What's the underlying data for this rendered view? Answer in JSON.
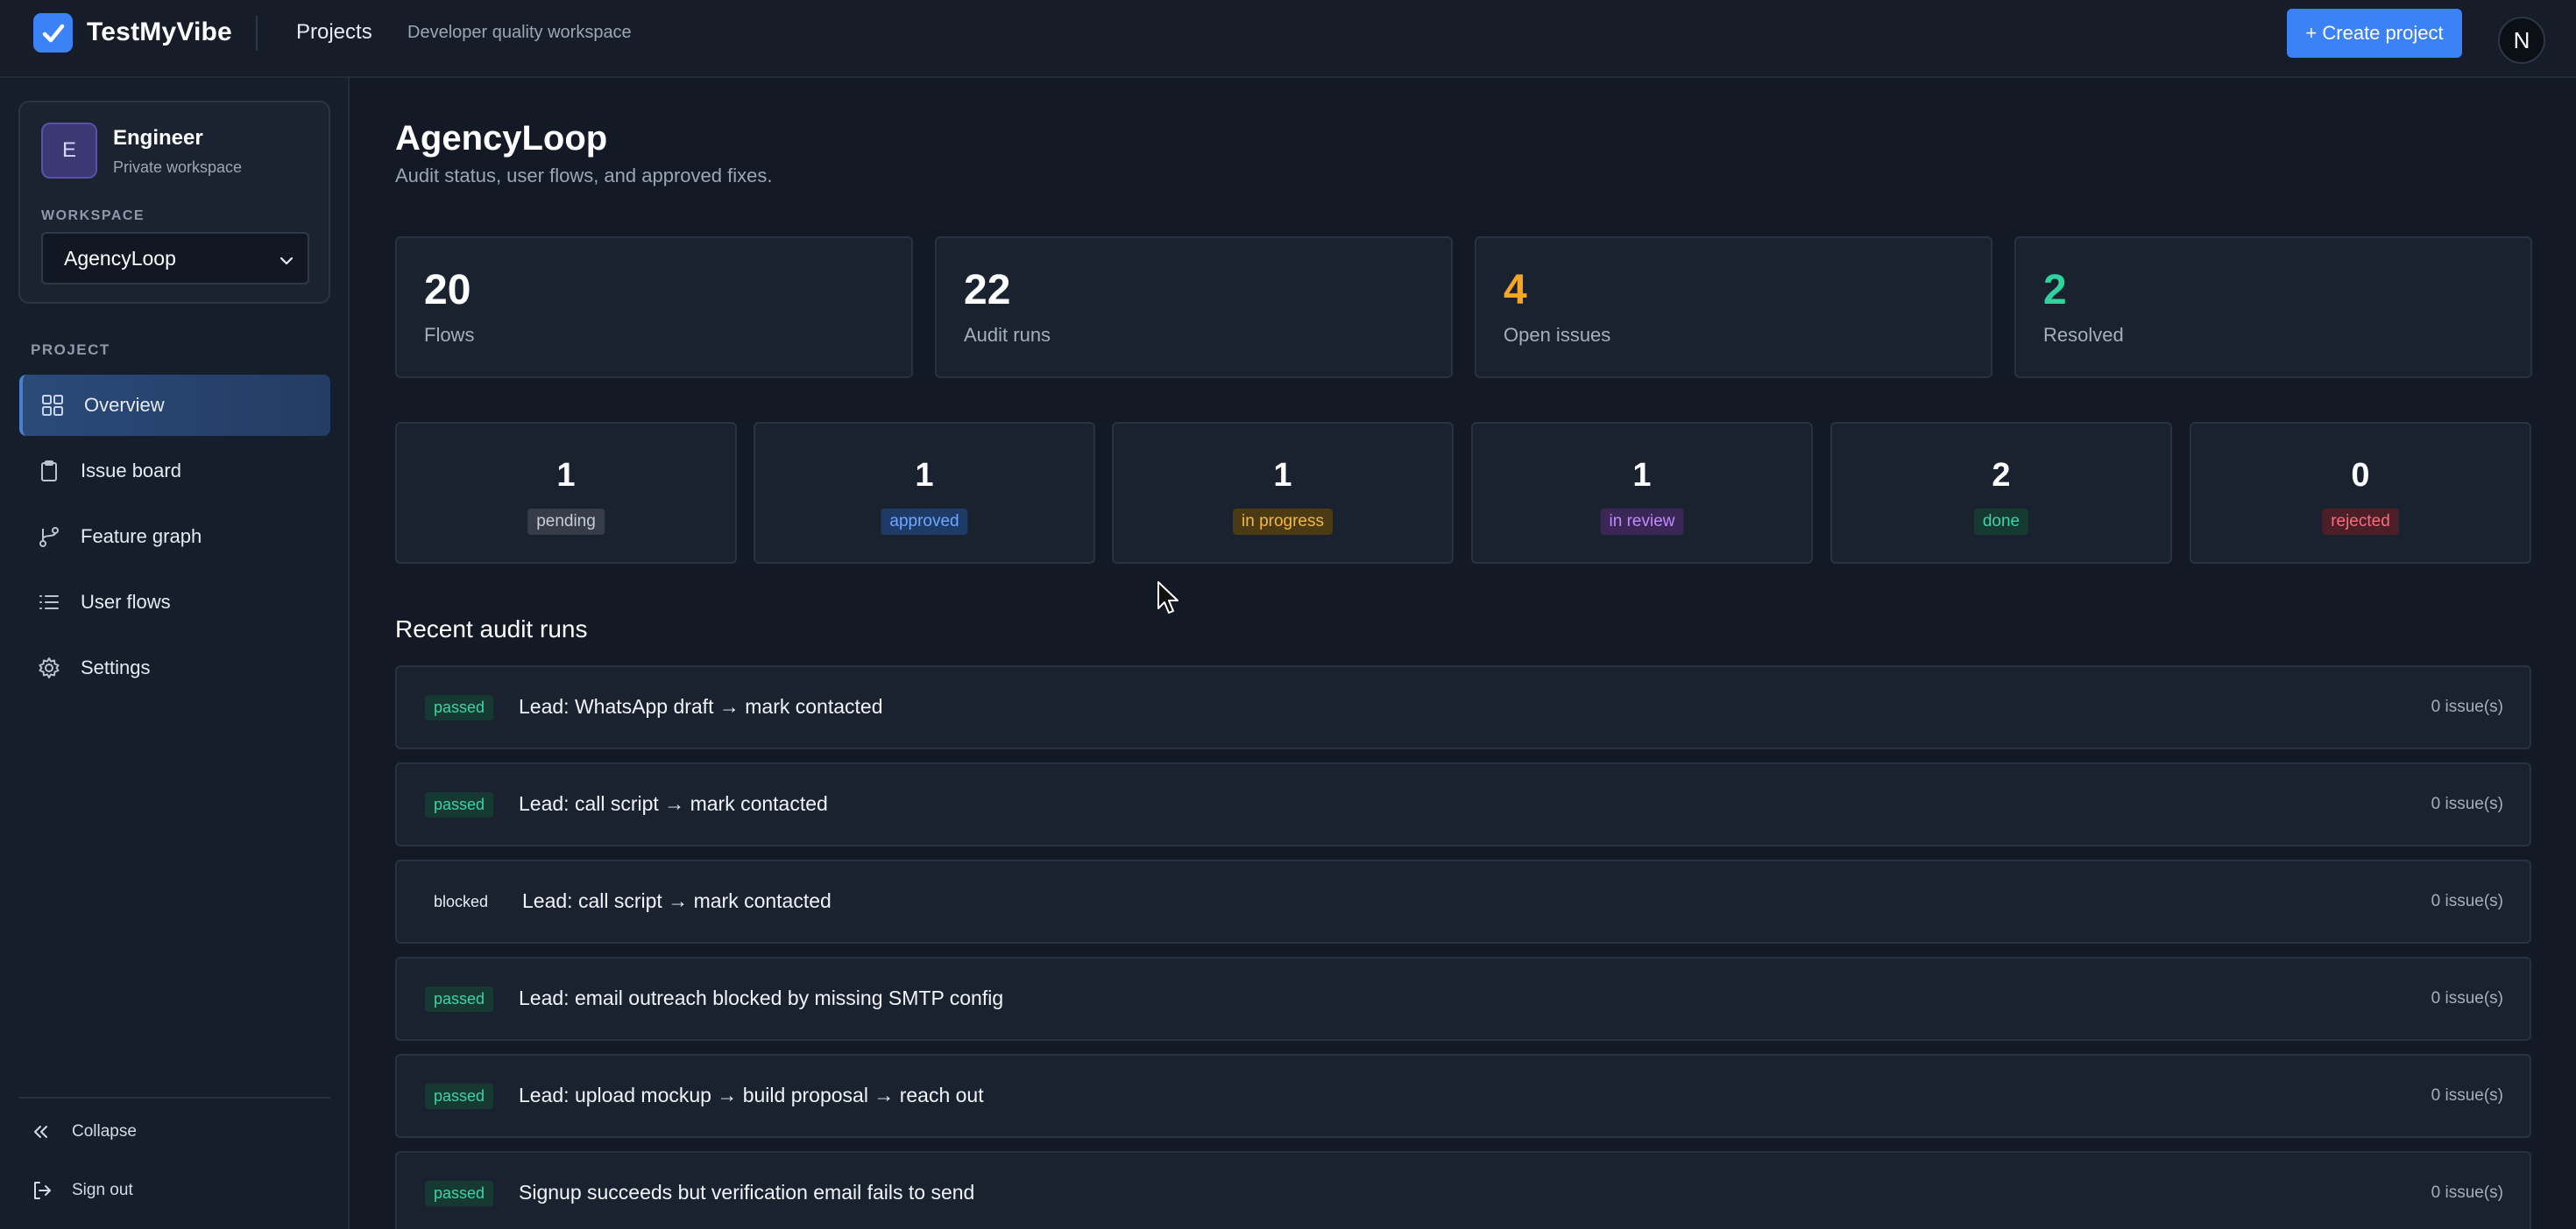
{
  "header": {
    "brand": "TestMyVibe",
    "nav_projects": "Projects",
    "subtitle": "Developer quality workspace",
    "create_button": "+ Create project",
    "avatar_initial": "N"
  },
  "sidebar": {
    "workspace_card": {
      "avatar_initial": "E",
      "name": "Engineer",
      "type": "Private workspace",
      "label": "WORKSPACE",
      "selected": "AgencyLoop"
    },
    "project_label": "PROJECT",
    "items": [
      {
        "label": "Overview",
        "icon": "grid-icon",
        "active": true
      },
      {
        "label": "Issue board",
        "icon": "clipboard-icon",
        "active": false
      },
      {
        "label": "Feature graph",
        "icon": "branch-icon",
        "active": false
      },
      {
        "label": "User flows",
        "icon": "list-icon",
        "active": false
      },
      {
        "label": "Settings",
        "icon": "gear-icon",
        "active": false
      }
    ],
    "collapse": "Collapse",
    "sign_out": "Sign out"
  },
  "main": {
    "title": "AgencyLoop",
    "subtitle": "Audit status, user flows, and approved fixes.",
    "stats": [
      {
        "value": "20",
        "label": "Flows",
        "color": "#ffffff"
      },
      {
        "value": "22",
        "label": "Audit runs",
        "color": "#ffffff"
      },
      {
        "value": "4",
        "label": "Open issues",
        "color": "#f5a524"
      },
      {
        "value": "2",
        "label": "Resolved",
        "color": "#2fd39b"
      }
    ],
    "statuses": [
      {
        "value": "1",
        "label": "pending",
        "bg": "#363d49",
        "fg": "#c6cdd7"
      },
      {
        "value": "1",
        "label": "approved",
        "bg": "#1e3a66",
        "fg": "#6ea8ff"
      },
      {
        "value": "1",
        "label": "in progress",
        "bg": "#4a3b14",
        "fg": "#f5b83d"
      },
      {
        "value": "1",
        "label": "in review",
        "bg": "#3b2756",
        "fg": "#c08aff"
      },
      {
        "value": "2",
        "label": "done",
        "bg": "#163a31",
        "fg": "#3fd3a0"
      },
      {
        "value": "0",
        "label": "rejected",
        "bg": "#4a1f27",
        "fg": "#ff6b7d"
      }
    ],
    "recent_title": "Recent audit runs",
    "runs": [
      {
        "status": "passed",
        "title": "Lead: WhatsApp draft → mark contacted",
        "count": "0 issue(s)"
      },
      {
        "status": "passed",
        "title": "Lead: call script → mark contacted",
        "count": "0 issue(s)"
      },
      {
        "status": "blocked",
        "title": "Lead: call script → mark contacted",
        "count": "0 issue(s)"
      },
      {
        "status": "passed",
        "title": "Lead: email outreach blocked by missing SMTP config",
        "count": "0 issue(s)"
      },
      {
        "status": "passed",
        "title": "Lead: upload mockup → build proposal → reach out",
        "count": "0 issue(s)"
      },
      {
        "status": "passed",
        "title": "Signup succeeds but verification email fails to send",
        "count": "0 issue(s)"
      }
    ]
  }
}
